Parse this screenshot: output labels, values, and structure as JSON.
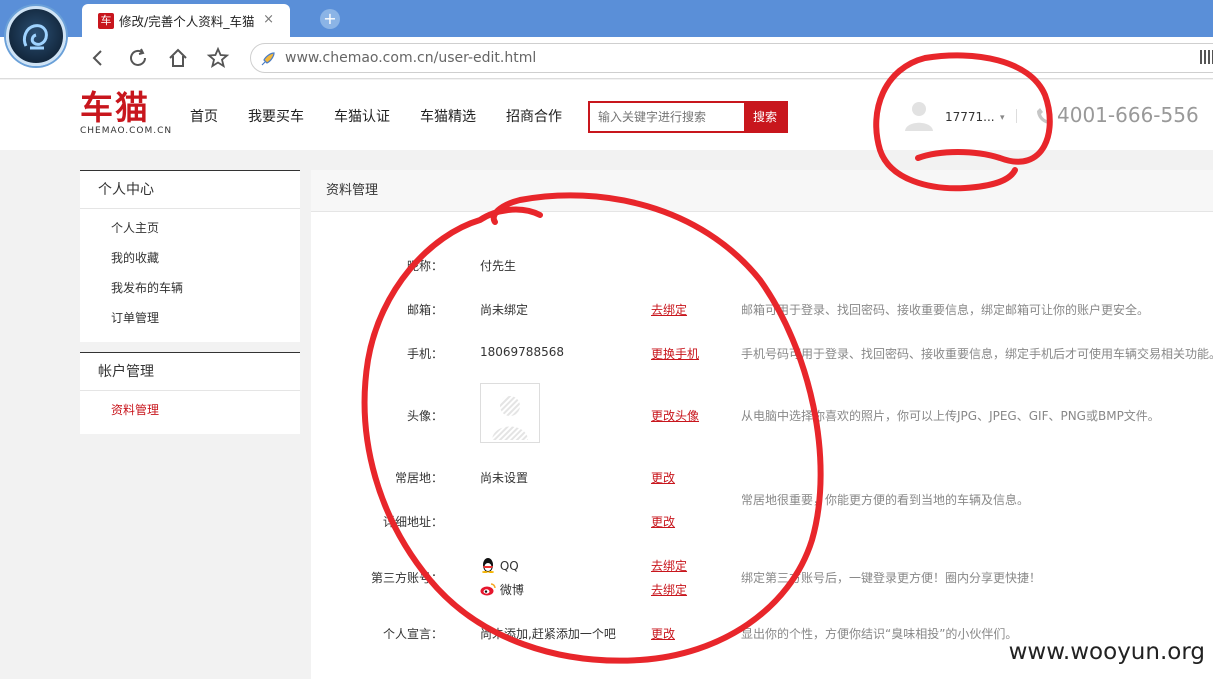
{
  "browser": {
    "tab_title": "修改/完善个人资料_车猫",
    "tab_favicon": "车",
    "close_glyph": "×",
    "newtab_glyph": "+",
    "url": "www.chemao.com.cn/user-edit.html"
  },
  "site": {
    "logo_cn": "车猫",
    "logo_en": "CHEMAO.COM.CN",
    "nav": [
      "首页",
      "我要买车",
      "车猫认证",
      "车猫精选",
      "招商合作"
    ],
    "search": {
      "placeholder": "输入关键字进行搜索",
      "button": "搜索"
    },
    "user": {
      "name": "17771...",
      "caret": "▾"
    },
    "hotline": "4001-666-556"
  },
  "sidebar": {
    "groups": [
      {
        "title": "个人中心",
        "items": [
          "个人主页",
          "我的收藏",
          "我发布的车辆",
          "订单管理"
        ]
      },
      {
        "title": "帐户管理",
        "items": [
          "资料管理"
        ]
      }
    ]
  },
  "panel": {
    "title": "资料管理",
    "rows": {
      "nickname": {
        "label": "昵称：",
        "value": "付先生"
      },
      "email": {
        "label": "邮箱：",
        "value": "尚未绑定",
        "action": "去绑定",
        "tip": "邮箱可用于登录、找回密码、接收重要信息，绑定邮箱可让你的账户更安全。"
      },
      "phone": {
        "label": "手机：",
        "value": "18069788568",
        "action": "更换手机",
        "tip": "手机号码可用于登录、找回密码、接收重要信息，绑定手机后才可使用车辆交易相关功能。"
      },
      "avatar": {
        "label": "头像：",
        "action": "更改头像",
        "tip": "从电脑中选择你喜欢的照片，你可以上传JPG、JPEG、GIF、PNG或BMP文件。"
      },
      "residence": {
        "label": "常居地：",
        "value": "尚未设置",
        "action": "更改"
      },
      "address": {
        "label": "详细地址：",
        "action": "更改"
      },
      "location_tip": "常居地很重要，你能更方便的看到当地的车辆及信息。",
      "third_party": {
        "label": "第三方账号：",
        "qq": "QQ",
        "qq_action": "去绑定",
        "weibo": "微博",
        "weibo_action": "去绑定",
        "tip": "绑定第三方账号后，一键登录更方便！圈内分享更快捷！"
      },
      "motto": {
        "label": "个人宣言：",
        "value": "尚未添加,赶紧添加一个吧",
        "action": "更改",
        "tip": "显出你的个性，方便你结识“臭味相投”的小伙伴们。"
      }
    }
  },
  "watermark": "www.wooyun.org",
  "colors": {
    "brand": "#c8161d",
    "annotation": "#e8262b",
    "browser_bar": "#5a8fd8"
  }
}
